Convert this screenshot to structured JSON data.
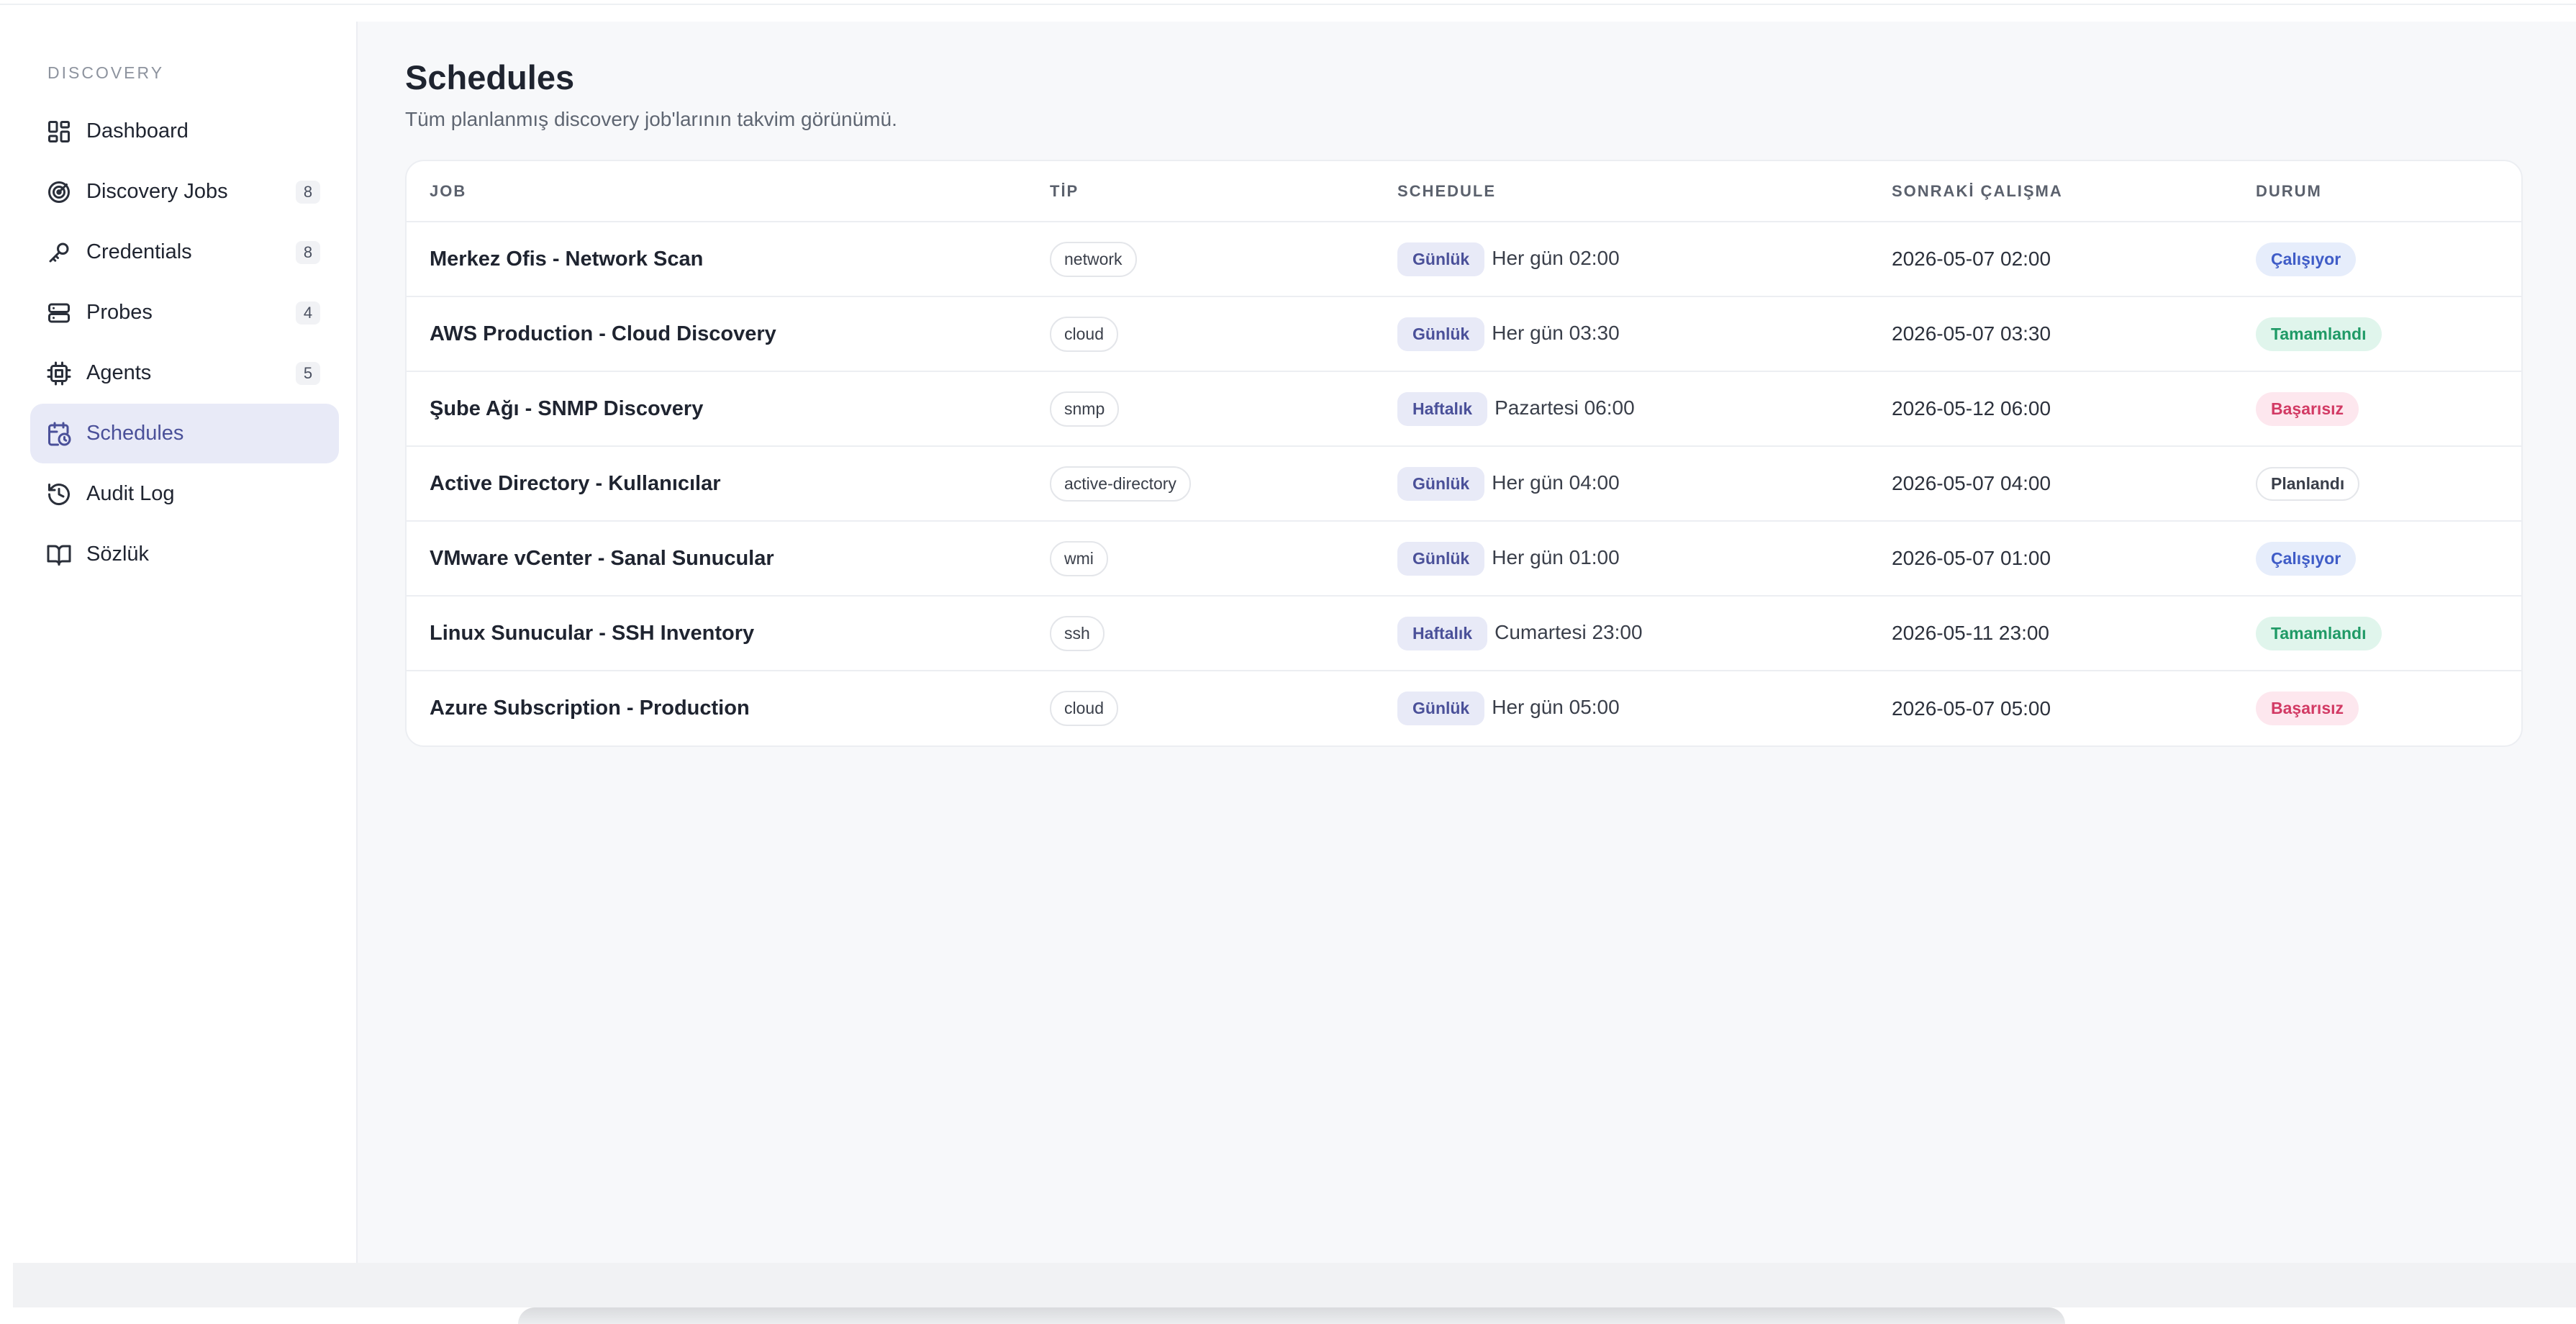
{
  "sidebar": {
    "section_title": "DISCOVERY",
    "items": [
      {
        "label": "Dashboard",
        "icon": "dashboard-icon",
        "count": ""
      },
      {
        "label": "Discovery Jobs",
        "icon": "radar-icon",
        "count": "8"
      },
      {
        "label": "Credentials",
        "icon": "key-icon",
        "count": "8"
      },
      {
        "label": "Probes",
        "icon": "server-icon",
        "count": "4"
      },
      {
        "label": "Agents",
        "icon": "cpu-icon",
        "count": "5"
      },
      {
        "label": "Schedules",
        "icon": "calendar-clock-icon",
        "count": "",
        "active": true
      },
      {
        "label": "Audit Log",
        "icon": "history-icon",
        "count": ""
      },
      {
        "label": "Sözlük",
        "icon": "book-icon",
        "count": ""
      }
    ]
  },
  "main": {
    "title": "Schedules",
    "subtitle": "Tüm planlanmış discovery job'larının takvim görünümü.",
    "table": {
      "headers": [
        "JOB",
        "TİP",
        "SCHEDULE",
        "SONRAKİ ÇALIŞMA",
        "DURUM"
      ],
      "rows": [
        {
          "job": "Merkez Ofis - Network Scan",
          "type": "network",
          "freq": "Günlük",
          "schedule": "Her gün 02:00",
          "next": "2026-05-07 02:00",
          "status": "Çalışıyor",
          "status_kind": "running"
        },
        {
          "job": "AWS Production - Cloud Discovery",
          "type": "cloud",
          "freq": "Günlük",
          "schedule": "Her gün 03:30",
          "next": "2026-05-07 03:30",
          "status": "Tamamlandı",
          "status_kind": "done"
        },
        {
          "job": "Şube Ağı - SNMP Discovery",
          "type": "snmp",
          "freq": "Haftalık",
          "schedule": "Pazartesi 06:00",
          "next": "2026-05-12 06:00",
          "status": "Başarısız",
          "status_kind": "fail"
        },
        {
          "job": "Active Directory - Kullanıcılar",
          "type": "active-directory",
          "freq": "Günlük",
          "schedule": "Her gün 04:00",
          "next": "2026-05-07 04:00",
          "status": "Planlandı",
          "status_kind": "planned"
        },
        {
          "job": "VMware vCenter - Sanal Sunucular",
          "type": "wmi",
          "freq": "Günlük",
          "schedule": "Her gün 01:00",
          "next": "2026-05-07 01:00",
          "status": "Çalışıyor",
          "status_kind": "running"
        },
        {
          "job": "Linux Sunucular - SSH Inventory",
          "type": "ssh",
          "freq": "Haftalık",
          "schedule": "Cumartesi 23:00",
          "next": "2026-05-11 23:00",
          "status": "Tamamlandı",
          "status_kind": "done"
        },
        {
          "job": "Azure Subscription - Production",
          "type": "cloud",
          "freq": "Günlük",
          "schedule": "Her gün 05:00",
          "next": "2026-05-07 05:00",
          "status": "Başarısız",
          "status_kind": "fail"
        }
      ]
    }
  },
  "colors": {
    "accent": "#4a5099",
    "active_bg": "#e8eaf7",
    "running": "#3f5cc7",
    "done": "#1f9a66",
    "fail": "#d23a64"
  }
}
